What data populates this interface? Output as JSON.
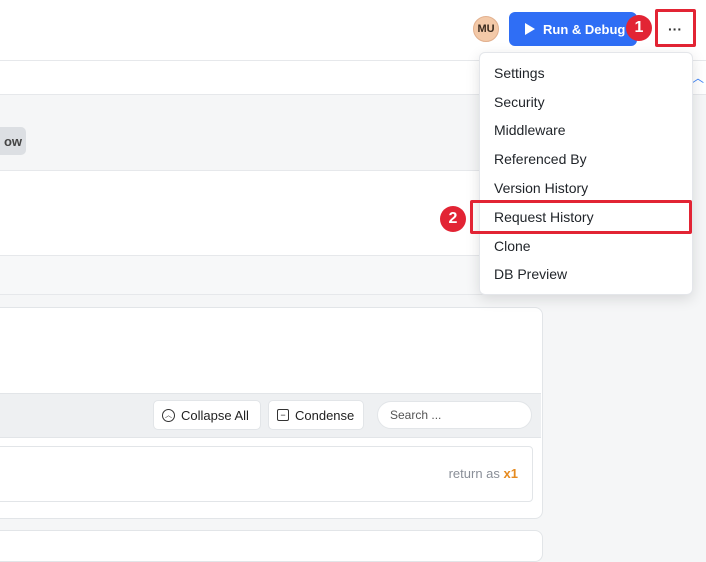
{
  "header": {
    "avatar_initials": "MU",
    "run_debug_label": "Run & Debug",
    "more_label": "···"
  },
  "annotations": {
    "step1": "1",
    "step2": "2",
    "highlight_color": "#e22434"
  },
  "partial": {
    "chip_text": "ow"
  },
  "toolbar": {
    "collapse_all_label": "Collapse All",
    "condense_label": "Condense",
    "search_placeholder": "Search ..."
  },
  "result": {
    "return_prefix": "return as",
    "return_ref": "x1"
  },
  "menu": {
    "items": [
      "Settings",
      "Security",
      "Middleware",
      "Referenced By",
      "Version History",
      "Request History",
      "Clone",
      "DB Preview"
    ]
  },
  "colors": {
    "accent": "#2f6ef5",
    "return_ref": "#e58a1f"
  }
}
